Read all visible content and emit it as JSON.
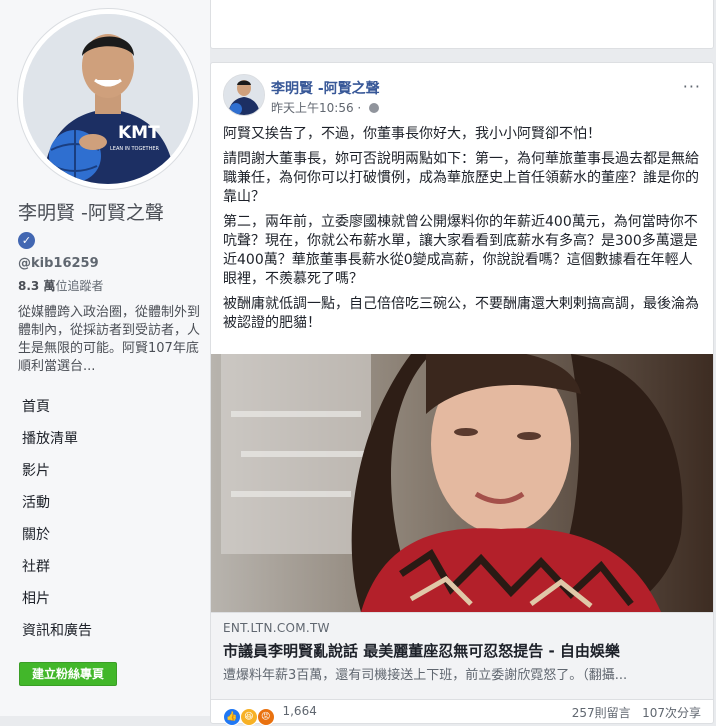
{
  "sidebar": {
    "page_name": "李明賢 -阿賢之聲",
    "handle": "@kib16259",
    "followers_count": "8.3 萬",
    "followers_label": "位追蹤者",
    "description": "從媒體跨入政治圈，從體制外到體制內，從採訪者到受訪者，人生是無限的可能。阿賢107年底順利當選台...",
    "shirt_text": "KMT",
    "shirt_sub": "LEAN IN TOGETHER",
    "nav_items": [
      "首頁",
      "播放清單",
      "影片",
      "活動",
      "關於",
      "社群",
      "相片",
      "資訊和廣告"
    ],
    "create_button": "建立粉絲專頁"
  },
  "post": {
    "author": "李明賢 -阿賢之聲",
    "timestamp": "昨天上午10:56",
    "paragraphs": [
      "阿賢又挨告了，不過，你董事長你好大，我小小阿賢卻不怕！",
      "請問謝大董事長，妳可否說明兩點如下：第一，為何華旅董事長過去都是無給職兼任，為何你可以打破慣例，成為華旅歷史上首任領薪水的董座？誰是你的靠山？",
      "第二，兩年前，立委廖國棟就曾公開爆料你的年薪近400萬元，為何當時你不吭聲？現在，你就公布薪水單，讓大家看看到底薪水有多高？是300多萬還是近400萬？華旅董事長薪水從0變成高薪，你說說看嗎？這個數據看在年輕人眼裡，不羨慕死了嗎？",
      "被酬庸就低調一點，自己倍倍吃三碗公，不要酬庸還大剌剌搞高調，最後淪為被認證的肥貓！"
    ],
    "link": {
      "domain": "ENT.LTN.COM.TW",
      "title": "市議員李明賢亂說話 最美麗董座忍無可忍怒提告 - 自由娛樂",
      "description": "遭爆料年薪3百萬，還有司機接送上下班，前立委謝欣霓怒了。（翻攝..."
    },
    "reactions_count": "1,664",
    "comments": "257則留言",
    "shares": "107次分享"
  }
}
